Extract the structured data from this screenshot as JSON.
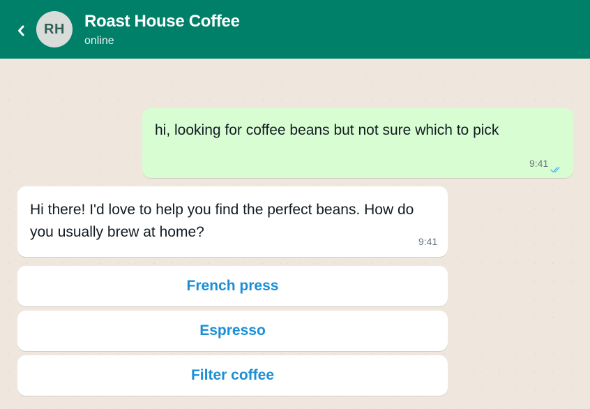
{
  "header": {
    "back_icon": "chevron-left-icon",
    "avatar_initials": "RH",
    "contact_name": "Roast House Coffee",
    "status": "online",
    "background_color": "#008069"
  },
  "messages": [
    {
      "direction": "outgoing",
      "text": "hi, looking for coffee beans but not sure which to pick",
      "time": "9:41",
      "status_icon": "double-check-icon"
    },
    {
      "direction": "incoming",
      "text": "Hi there! I'd love to help you find the perfect beans. How do you usually brew at home?",
      "time": "9:41"
    }
  ],
  "quick_replies": [
    {
      "label": "French press"
    },
    {
      "label": "Espresso"
    },
    {
      "label": "Filter coffee"
    }
  ],
  "colors": {
    "outgoing_bubble": "#d9fdd3",
    "incoming_bubble": "#ffffff",
    "chat_background": "#efe7dd",
    "quick_reply_text": "#1a8fd6",
    "read_ticks": "#53bdeb"
  }
}
